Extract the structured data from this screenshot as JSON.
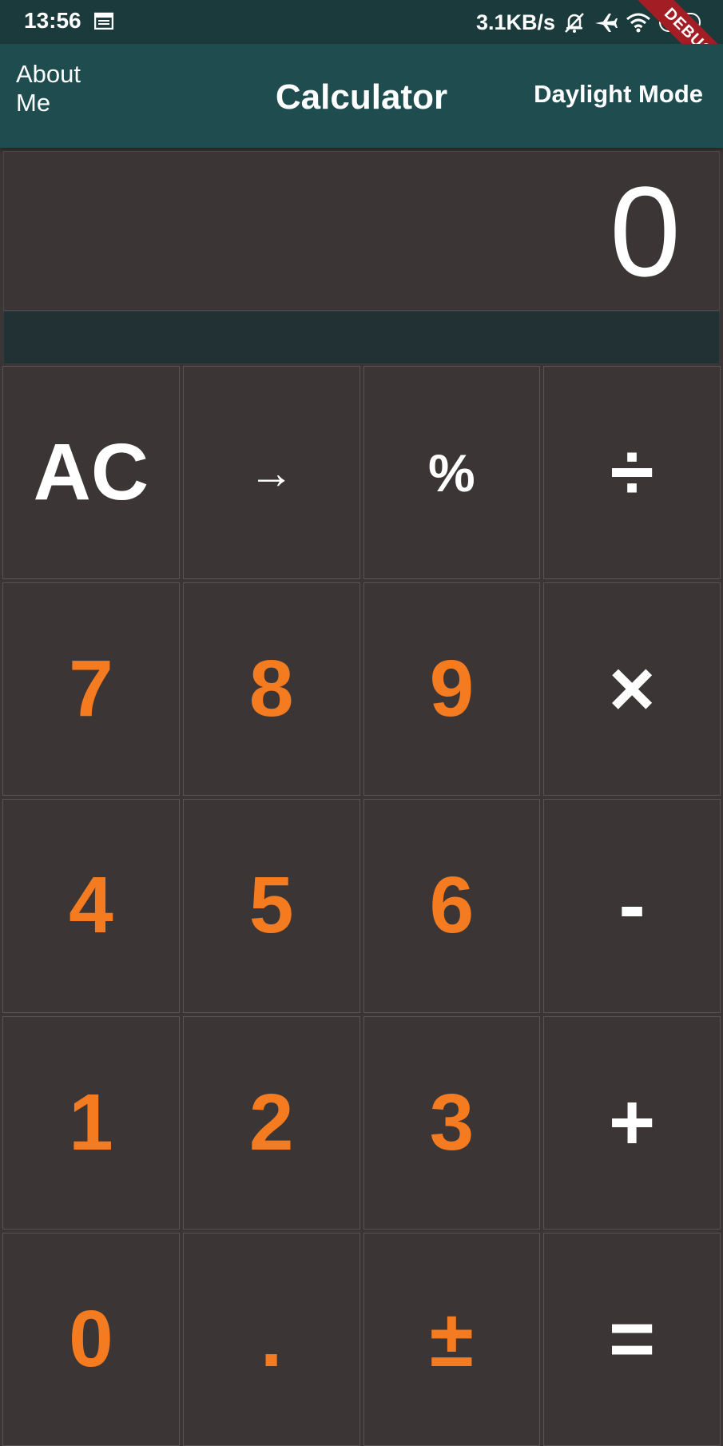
{
  "status_bar": {
    "time": "13:56",
    "network_speed": "3.1KB/s",
    "battery": "28",
    "icons": [
      "calendar-icon",
      "bell-off-icon",
      "airplane-icon",
      "wifi-icon",
      "battery-icon"
    ]
  },
  "debug_banner": "DEBUG",
  "app_bar": {
    "left_action": "About Me",
    "title": "Calculator",
    "right_action": "Daylight Mode"
  },
  "display": {
    "value": "0"
  },
  "keypad": {
    "rows": [
      [
        {
          "label": "AC",
          "type": "op"
        },
        {
          "label": "→",
          "type": "op"
        },
        {
          "label": "%",
          "type": "op"
        },
        {
          "label": "÷",
          "type": "op"
        }
      ],
      [
        {
          "label": "7",
          "type": "num"
        },
        {
          "label": "8",
          "type": "num"
        },
        {
          "label": "9",
          "type": "num"
        },
        {
          "label": "×",
          "type": "op"
        }
      ],
      [
        {
          "label": "4",
          "type": "num"
        },
        {
          "label": "5",
          "type": "num"
        },
        {
          "label": "6",
          "type": "num"
        },
        {
          "label": "-",
          "type": "op"
        }
      ],
      [
        {
          "label": "1",
          "type": "num"
        },
        {
          "label": "2",
          "type": "num"
        },
        {
          "label": "3",
          "type": "num"
        },
        {
          "label": "+",
          "type": "op"
        }
      ],
      [
        {
          "label": "0",
          "type": "num"
        },
        {
          "label": ".",
          "type": "num"
        },
        {
          "label": "±",
          "type": "num"
        },
        {
          "label": "=",
          "type": "op"
        }
      ]
    ]
  },
  "colors": {
    "accent": "#f47b20",
    "app_bar": "#1f4d4f",
    "status_bar": "#1b3a3c",
    "key_background": "#3b3535",
    "debug_ribbon": "#a31d25"
  }
}
